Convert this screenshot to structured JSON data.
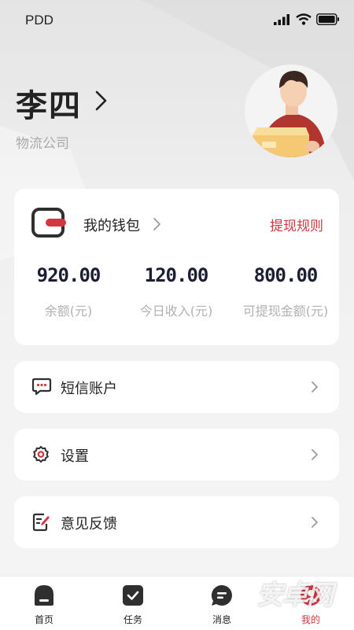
{
  "status_bar": {
    "carrier": "PDD"
  },
  "profile": {
    "name": "李四",
    "company": "物流公司"
  },
  "wallet": {
    "title": "我的钱包",
    "rule_link": "提现规则",
    "stats": [
      {
        "value": "920.00",
        "label": "余额(元)"
      },
      {
        "value": "120.00",
        "label": "今日收入(元)"
      },
      {
        "value": "800.00",
        "label": "可提现金额(元)"
      }
    ]
  },
  "menu": [
    {
      "label": "短信账户",
      "icon": "sms-icon"
    },
    {
      "label": "设置",
      "icon": "settings-icon"
    },
    {
      "label": "意见反馈",
      "icon": "feedback-icon"
    }
  ],
  "tabs": [
    {
      "label": "首页",
      "icon": "home-icon",
      "active": false
    },
    {
      "label": "任务",
      "icon": "task-icon",
      "active": false
    },
    {
      "label": "消息",
      "icon": "message-icon",
      "active": false
    },
    {
      "label": "我的",
      "icon": "profile-icon",
      "active": true
    }
  ],
  "watermark": "安卓网",
  "colors": {
    "accent": "#d4363f",
    "dark": "#2f2f2f",
    "text": "#222222",
    "muted": "#a9a9a9",
    "stat_value": "#1c1f33"
  }
}
